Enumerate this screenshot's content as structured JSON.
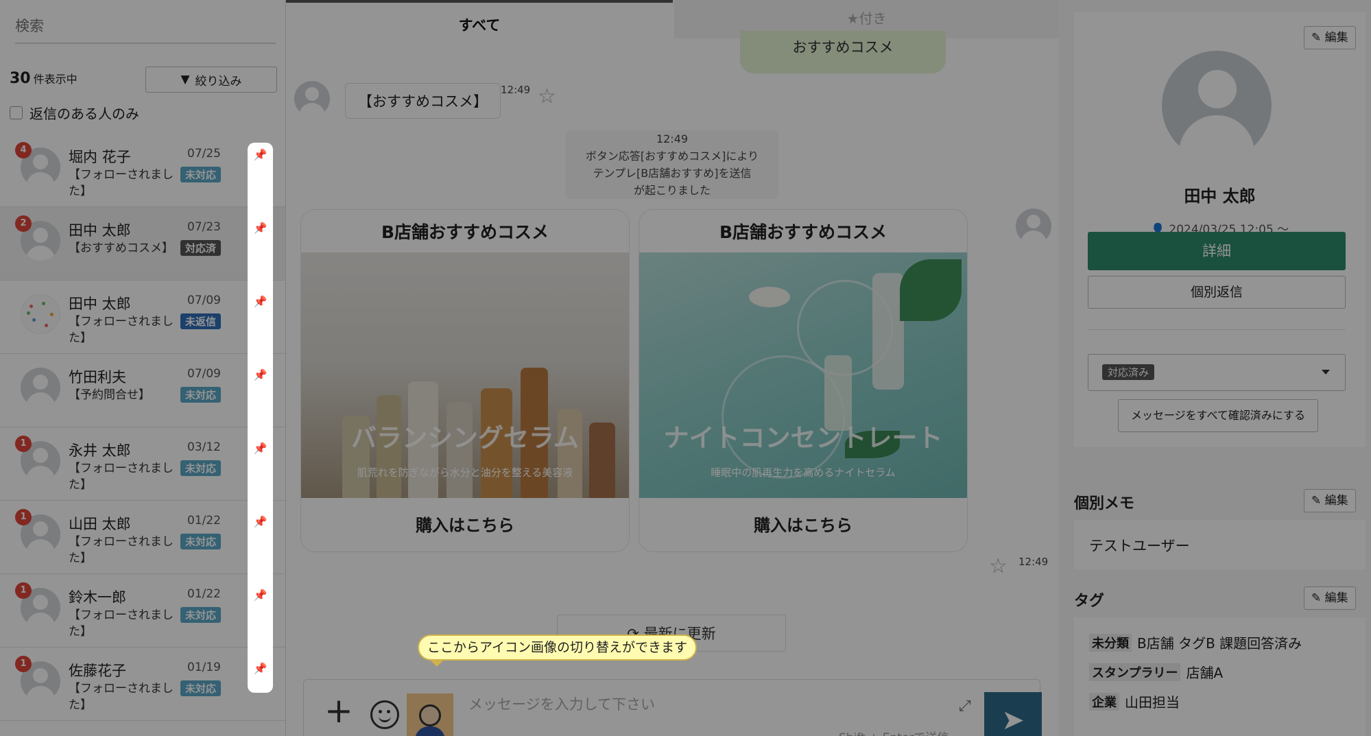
{
  "sidebar": {
    "search_placeholder": "検索",
    "count_number": "30",
    "count_suffix": "件表示中",
    "filter_label": "絞り込み",
    "reply_only_label": "返信のある人のみ",
    "conversations": [
      {
        "name": "堀内 花子",
        "preview": "【フォローされました】",
        "date": "07/25",
        "status": "未対応",
        "unread": "4"
      },
      {
        "name": "田中 太郎",
        "preview": "【おすすめコスメ】",
        "date": "07/23",
        "status": "対応済",
        "unread": "2"
      },
      {
        "name": "田中 太郎",
        "preview": "【フォローされました】",
        "date": "07/09",
        "status": "未返信",
        "unread": ""
      },
      {
        "name": "竹田利夫",
        "preview": "【予約問合せ】",
        "date": "07/09",
        "status": "未対応",
        "unread": ""
      },
      {
        "name": "永井 太郎",
        "preview": "【フォローされました】",
        "date": "03/12",
        "status": "未対応",
        "unread": "1"
      },
      {
        "name": "山田 太郎",
        "preview": "【フォローされました】",
        "date": "01/22",
        "status": "未対応",
        "unread": "1"
      },
      {
        "name": "鈴木一郎",
        "preview": "【フォローされました】",
        "date": "01/22",
        "status": "未対応",
        "unread": "1"
      },
      {
        "name": "佐藤花子",
        "preview": "【フォローされました】",
        "date": "01/19",
        "status": "未対応",
        "unread": "1"
      }
    ]
  },
  "chat": {
    "tabs": {
      "all": "すべて",
      "starred": "★付き"
    },
    "top_bubble": "おすすめコスメ",
    "msg_left": "【おすすめコスメ】",
    "time_1": "12:49",
    "system_time": "12:49",
    "system_lines": [
      "ボタン応答[おすすめコスメ]により",
      "テンプレ[B店舗おすすめ]を送信",
      "が起こりました"
    ],
    "cards": [
      {
        "title": "B店舗おすすめコスメ",
        "headline": "バランシングセラム",
        "sub": "肌荒れを防ぎながら水分と油分を整える美容液",
        "button": "購入はこちら"
      },
      {
        "title": "B店舗おすすめコスメ",
        "headline": "ナイトコンセントレート",
        "sub": "睡眠中の肌再生力を高めるナイトセラム",
        "button": "購入はこちら"
      }
    ],
    "time_2": "12:49",
    "refresh_label": "最新に更新",
    "tooltip": "ここからアイコン画像の切り替えができます",
    "input_placeholder": "メッセージを入力して下さい",
    "send_hint": "Shift + Enterで送信"
  },
  "profile": {
    "edit_label": "編集",
    "name": "田中 太郎",
    "since": "2024/03/25 12:05 〜",
    "detail_label": "詳細",
    "reply_label": "個別返信",
    "status_value": "対応済み",
    "mark_all_label": "メッセージをすべて確認済みにする",
    "memo_title": "個別メモ",
    "memo_text": "テストユーザー",
    "tags_title": "タグ",
    "tag_rows": [
      {
        "cat": "未分類",
        "items": "B店舗 タグB 課題回答済み"
      },
      {
        "cat": "スタンプラリー",
        "items": "店舗A"
      },
      {
        "cat": "企業",
        "items": "山田担当"
      }
    ]
  },
  "colors": {
    "accent_green": "#2d8a6b",
    "unread_badge": "#e0453a",
    "pin_blue": "#2f6fb8",
    "tooltip_bg": "#fffbb0"
  }
}
